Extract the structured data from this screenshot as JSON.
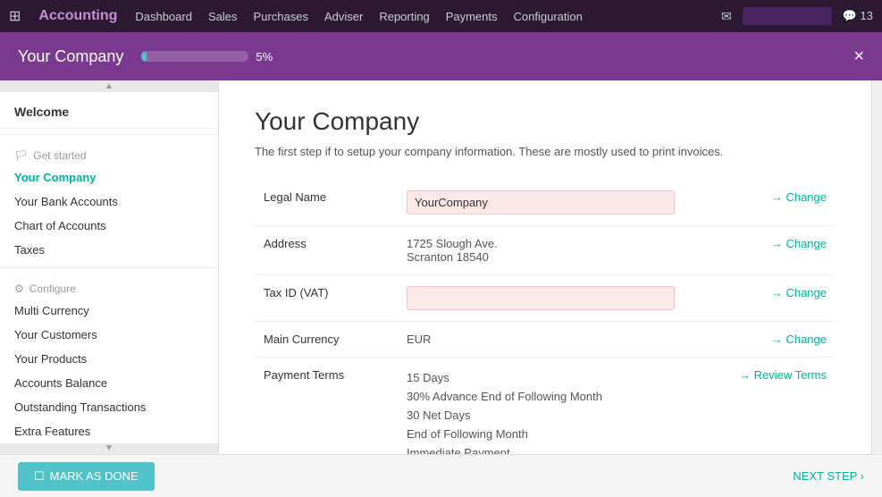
{
  "topbar": {
    "app_title": "Accounting",
    "nav_items": [
      "Dashboard",
      "Sales",
      "Purchases",
      "Adviser",
      "Reporting",
      "Payments",
      "Configuration"
    ],
    "chat_count": "13"
  },
  "modal": {
    "title": "Your Company",
    "progress_percent": 5,
    "progress_label": "5%",
    "close_label": "×"
  },
  "sidebar": {
    "welcome_label": "Welcome",
    "get_started_label": "Get started",
    "configure_label": "Configure",
    "items_get_started": [
      {
        "label": "Your Company",
        "active": true
      },
      {
        "label": "Your Bank Accounts",
        "active": false
      },
      {
        "label": "Chart of Accounts",
        "active": false
      },
      {
        "label": "Taxes",
        "active": false
      }
    ],
    "items_configure": [
      {
        "label": "Multi Currency",
        "active": false
      },
      {
        "label": "Your Customers",
        "active": false
      },
      {
        "label": "Your Products",
        "active": false
      },
      {
        "label": "Accounts Balance",
        "active": false
      },
      {
        "label": "Outstanding Transactions",
        "active": false
      },
      {
        "label": "Extra Features",
        "active": false
      }
    ]
  },
  "main": {
    "title": "Your Company",
    "description": "The first step if to setup your company information. These are mostly used to print invoices.",
    "fields": [
      {
        "label": "Legal Name",
        "value": "YourCompany",
        "is_input": true,
        "action_label": "→ Change"
      },
      {
        "label": "Address",
        "value": "1725 Slough Ave.\nScranton 18540",
        "is_input": false,
        "action_label": "→ Change"
      },
      {
        "label": "Tax ID (VAT)",
        "value": "",
        "is_input": true,
        "action_label": "→ Change"
      },
      {
        "label": "Main Currency",
        "value": "EUR",
        "is_input": false,
        "action_label": "→ Change"
      },
      {
        "label": "Payment Terms",
        "value": "15 Days",
        "is_input": false,
        "action_label": "→ Review Terms",
        "extra_values": [
          "30% Advance End of Following Month",
          "30 Net Days",
          "End of Following Month",
          "Immediate Payment"
        ]
      }
    ]
  },
  "footer": {
    "mark_done_label": "MARK AS DONE",
    "next_step_label": "NEXT STEP ›"
  }
}
